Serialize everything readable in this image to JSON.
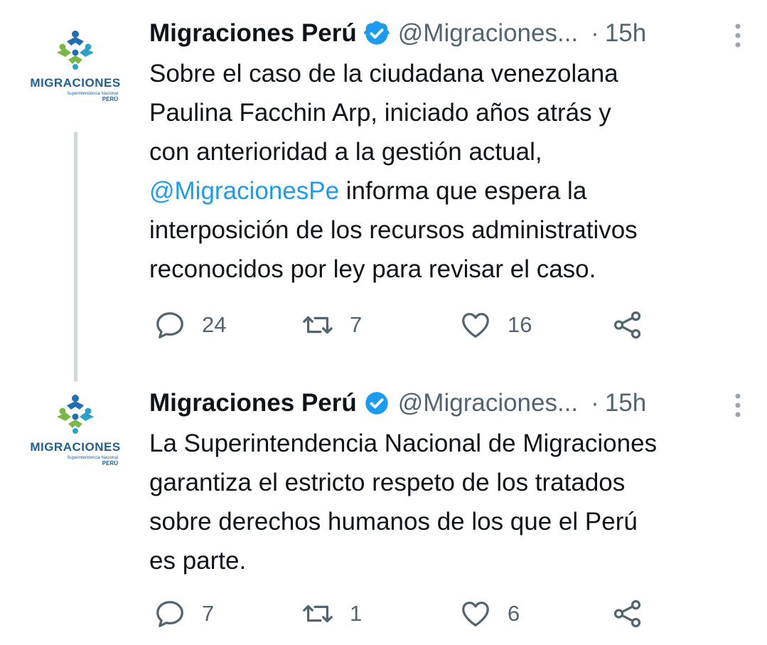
{
  "colors": {
    "text": "#0f1419",
    "secondary": "#536471",
    "link": "#1d9bf0",
    "verified": "#1d9bf0",
    "thread_line": "#cfd9de"
  },
  "logo": {
    "word": "MIGRACIONES",
    "sub": "Superintendencia Nacional",
    "country": "PERÚ"
  },
  "tweets": [
    {
      "name": "Migraciones Perú",
      "handle": "@Migraciones...",
      "sep": "·",
      "time": "15h",
      "text_before": "Sobre el caso de la ciudadana venezolana\nPaulina Facchin Arp, iniciado años atrás y\ncon anterioridad a la gestión actual,\n",
      "mention": "@MigracionesPe",
      "text_after": " informa que espera la\ninterposición de los recursos administrativos\nreconocidos por ley para revisar el caso.",
      "replies": "24",
      "retweets": "7",
      "likes": "16"
    },
    {
      "name": "Migraciones Perú",
      "handle": "@Migraciones...",
      "sep": "·",
      "time": "15h",
      "text": "La Superintendencia Nacional de Migraciones\ngarantiza el estricto respeto de los tratados\nsobre derechos humanos de los que el Perú\nes parte.",
      "replies": "7",
      "retweets": "1",
      "likes": "6"
    }
  ]
}
